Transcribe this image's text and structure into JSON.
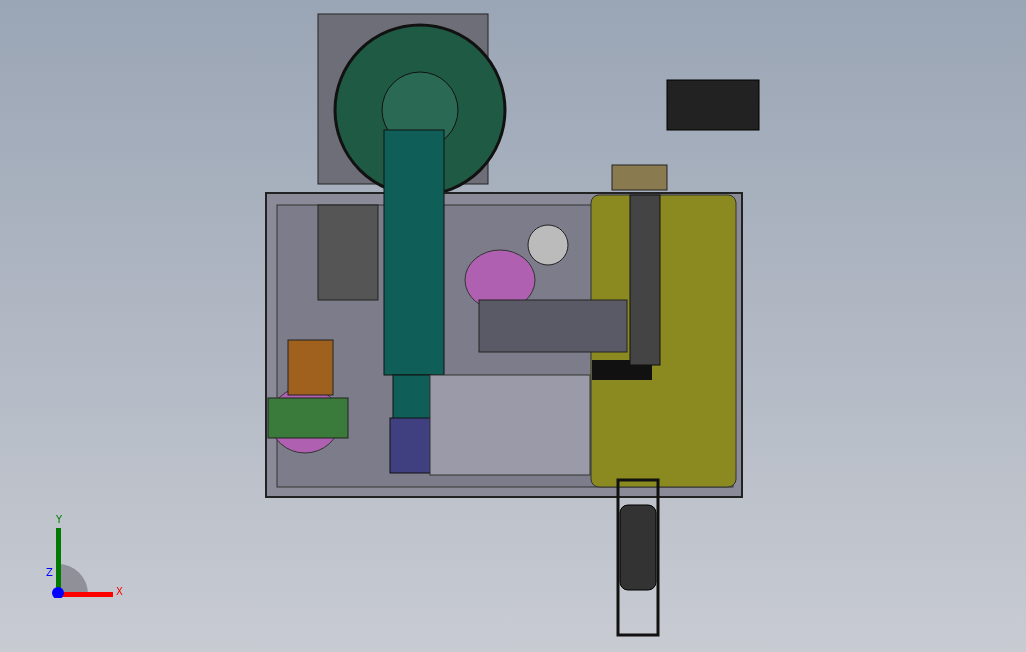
{
  "viewport": {
    "triad": {
      "axes": [
        {
          "label": "Y",
          "color": "#007a00"
        },
        {
          "label": "Z",
          "color": "#0000ff"
        },
        {
          "label": "X",
          "color": "#ff0000"
        }
      ]
    }
  }
}
